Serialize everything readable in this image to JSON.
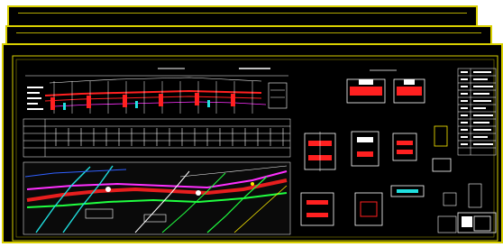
{
  "title": "",
  "sheets": [
    {
      "name": "sheet-back",
      "description": ""
    },
    {
      "name": "sheet-middle",
      "description": ""
    },
    {
      "name": "sheet-front",
      "description": ""
    }
  ],
  "colors": {
    "background": "#ffffff",
    "drawing_bg": "#000000",
    "frame": "#d9d000",
    "red": "#ff2020",
    "cyan": "#20e0e0",
    "green": "#20ff40",
    "magenta": "#ff30ff",
    "white": "#ffffff",
    "yellow": "#ffee00",
    "blue": "#3060ff"
  },
  "icons": [
    "cad-sheet-stack-icon"
  ]
}
